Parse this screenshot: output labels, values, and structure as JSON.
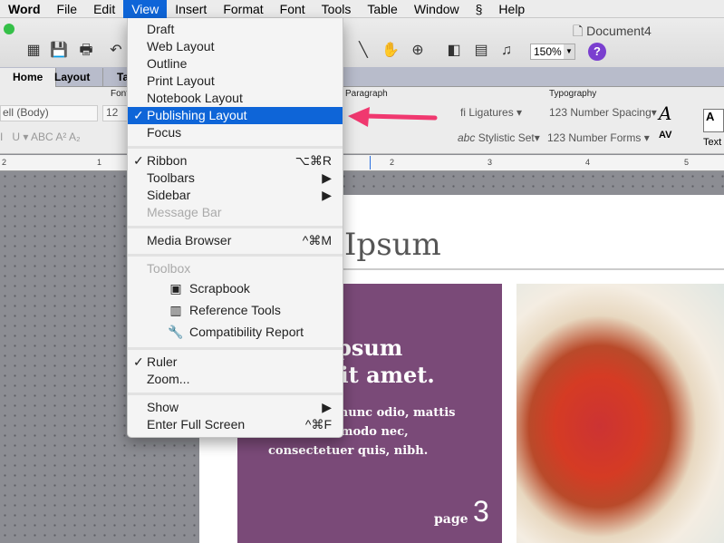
{
  "menubar": {
    "items": [
      "Word",
      "File",
      "Edit",
      "View",
      "Insert",
      "Format",
      "Font",
      "Tools",
      "Table",
      "Window",
      "Script",
      "Help"
    ],
    "active": "View"
  },
  "window": {
    "title": "Document4",
    "zoom": "150%"
  },
  "tabs": [
    "Home",
    "Layout",
    "Ta"
  ],
  "ribbon": {
    "groups": {
      "font": "Font",
      "paragraph": "Paragraph",
      "typography": "Typography"
    },
    "font_name": "ell (Body)",
    "font_size": "12",
    "ligatures": "Ligatures",
    "number_spacing": "Number Spacing",
    "stylistic_set": "Stylistic Set",
    "number_forms": "Number Forms",
    "text": "Text"
  },
  "ruler": {
    "marks": [
      "2",
      "1",
      "2",
      "3",
      "4",
      "5"
    ]
  },
  "document": {
    "heading": "Ipsum",
    "box_title_1": "ipsum",
    "box_title_2": "sit amet.",
    "box_body_1": "e nunc odio, mattis",
    "box_body_2": "mmodo nec,",
    "box_body_3": "consectetuer quis, nibh.",
    "page_label": "page",
    "page_number": "3",
    "accent": "#7a4a78"
  },
  "view_menu": {
    "items": [
      {
        "label": "Draft"
      },
      {
        "label": "Web Layout"
      },
      {
        "label": "Outline"
      },
      {
        "label": "Print Layout"
      },
      {
        "label": "Notebook Layout"
      },
      {
        "label": "Publishing Layout",
        "checked": "✓",
        "highlighted": true
      },
      {
        "label": "Focus"
      },
      {
        "label": "Ribbon",
        "checked": "✓",
        "shortcut": "⌥⌘R"
      },
      {
        "label": "Toolbars",
        "shortcut": "▶"
      },
      {
        "label": "Sidebar",
        "shortcut": "▶"
      },
      {
        "label": "Message Bar",
        "disabled": true
      },
      {
        "label": "Media Browser",
        "shortcut": "^⌘M"
      },
      {
        "label": "Toolbox",
        "disabled": true
      },
      {
        "label": "Scrapbook",
        "icon": "scrapbook-icon"
      },
      {
        "label": "Reference Tools",
        "icon": "books-icon"
      },
      {
        "label": "Compatibility Report",
        "icon": "wrench-icon"
      },
      {
        "label": "Ruler",
        "checked": "✓"
      },
      {
        "label": "Zoom..."
      },
      {
        "label": "Show",
        "shortcut": "▶"
      },
      {
        "label": "Enter Full Screen",
        "shortcut": "^⌘F"
      }
    ]
  },
  "colors": {
    "highlight": "#0e65d8",
    "arrow": "#f0386f"
  }
}
